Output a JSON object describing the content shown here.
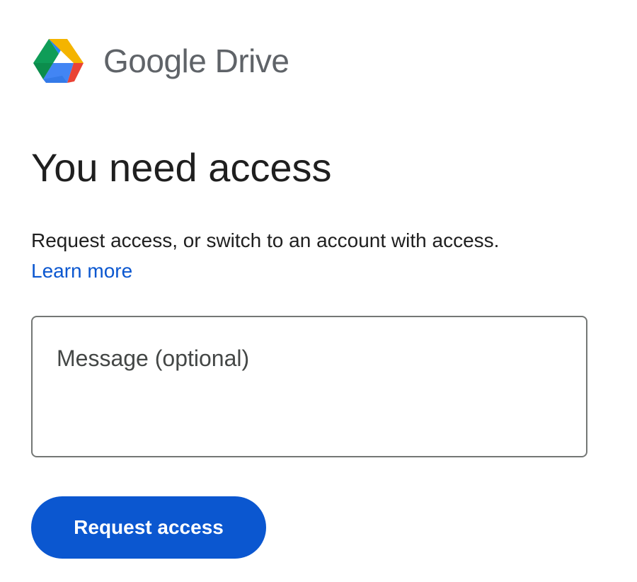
{
  "header": {
    "logo_icon": "google-drive-logo-icon",
    "product_name": "Google Drive"
  },
  "main": {
    "title": "You need access",
    "description": "Request access, or switch to an account with access.",
    "learn_more_label": "Learn more",
    "message": {
      "value": "",
      "placeholder": "Message (optional)"
    },
    "request_button_label": "Request access"
  },
  "colors": {
    "accent": "#0b57d0",
    "logo_green": "#0f9d58",
    "logo_yellow": "#f4b400",
    "logo_blue": "#4285f4",
    "logo_red": "#db4437"
  }
}
